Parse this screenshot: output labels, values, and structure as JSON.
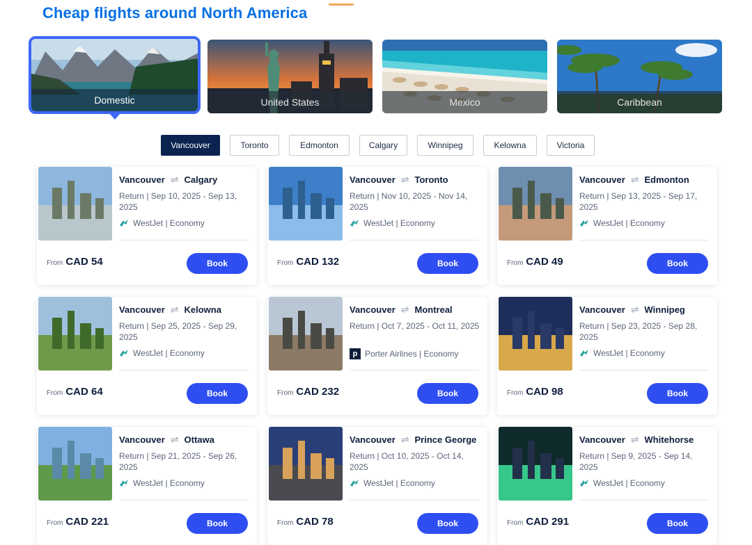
{
  "header": {
    "title": "Cheap flights around North America"
  },
  "regions": [
    {
      "label": "Domestic",
      "active": true
    },
    {
      "label": "United States",
      "active": false
    },
    {
      "label": "Mexico",
      "active": false
    },
    {
      "label": "Caribbean",
      "active": false
    }
  ],
  "cities": [
    "Vancouver",
    "Toronto",
    "Edmonton",
    "Calgary",
    "Winnipeg",
    "Kelowna",
    "Victoria"
  ],
  "selected_city": "Vancouver",
  "deals": [
    {
      "from": "Vancouver",
      "to": "Calgary",
      "dates": "Return | Sep 10, 2025 - Sep 13, 2025",
      "airline": "WestJet | Economy",
      "price_from": "From",
      "price": "CAD 54",
      "book": "Book",
      "icon": "westjet-icon"
    },
    {
      "from": "Vancouver",
      "to": "Toronto",
      "dates": "Return | Nov 10, 2025 - Nov 14, 2025",
      "airline": "WestJet | Economy",
      "price_from": "From",
      "price": "CAD 132",
      "book": "Book",
      "icon": "westjet-icon"
    },
    {
      "from": "Vancouver",
      "to": "Edmonton",
      "dates": "Return | Sep 13, 2025 - Sep 17, 2025",
      "airline": "WestJet | Economy",
      "price_from": "From",
      "price": "CAD 49",
      "book": "Book",
      "icon": "westjet-icon"
    },
    {
      "from": "Vancouver",
      "to": "Kelowna",
      "dates": "Return | Sep 25, 2025 - Sep 29, 2025",
      "airline": "WestJet | Economy",
      "price_from": "From",
      "price": "CAD 64",
      "book": "Book",
      "icon": "westjet-icon"
    },
    {
      "from": "Vancouver",
      "to": "Montreal",
      "dates": "Return | Oct 7, 2025 - Oct 11, 2025",
      "airline": "Porter Airlines | Economy",
      "price_from": "From",
      "price": "CAD 232",
      "book": "Book",
      "icon": "porter-icon",
      "icon_glyph": "p"
    },
    {
      "from": "Vancouver",
      "to": "Winnipeg",
      "dates": "Return | Sep 23, 2025 - Sep 28, 2025",
      "airline": "WestJet | Economy",
      "price_from": "From",
      "price": "CAD 98",
      "book": "Book",
      "icon": "westjet-icon"
    },
    {
      "from": "Vancouver",
      "to": "Ottawa",
      "dates": "Return | Sep 21, 2025 - Sep 26, 2025",
      "airline": "WestJet | Economy",
      "price_from": "From",
      "price": "CAD 221",
      "book": "Book",
      "icon": "westjet-icon"
    },
    {
      "from": "Vancouver",
      "to": "Prince George",
      "dates": "Return | Oct 10, 2025 - Oct 14, 2025",
      "airline": "WestJet | Economy",
      "price_from": "From",
      "price": "CAD 78",
      "book": "Book",
      "icon": "westjet-icon"
    },
    {
      "from": "Vancouver",
      "to": "Whitehorse",
      "dates": "Return | Sep 9, 2025 - Sep 14, 2025",
      "airline": "WestJet | Economy",
      "price_from": "From",
      "price": "CAD 291",
      "book": "Book",
      "icon": "westjet-icon"
    }
  ],
  "colors": {
    "accent": "#2f4ef2",
    "title": "#0770e3",
    "selected_chip": "#0b2350",
    "active_tile_border": "#3d67f5"
  }
}
